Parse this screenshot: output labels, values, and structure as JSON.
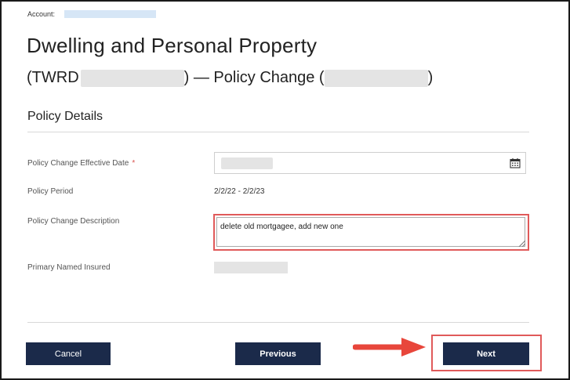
{
  "header": {
    "account_label": "Account:",
    "title": "Dwelling and Personal Property",
    "subtitle_prefix": "(TWRD",
    "subtitle_middle": ") — Policy Change (",
    "subtitle_suffix": ")"
  },
  "section": {
    "title": "Policy Details"
  },
  "fields": {
    "effective_date_label": "Policy Change Effective Date",
    "required_marker": "*",
    "policy_period_label": "Policy Period",
    "policy_period_value": "2/2/22 - 2/2/23",
    "description_label": "Policy Change Description",
    "description_value": "delete old mortgagee, add new one",
    "insured_label": "Primary Named Insured"
  },
  "actions": {
    "cancel": "Cancel",
    "previous": "Previous",
    "next": "Next"
  },
  "colors": {
    "button_bg": "#1b2a4a",
    "highlight": "#e05a5a",
    "required": "#d9534f"
  },
  "icons": {
    "date": "calendar-icon",
    "arrow": "red-arrow-icon"
  }
}
